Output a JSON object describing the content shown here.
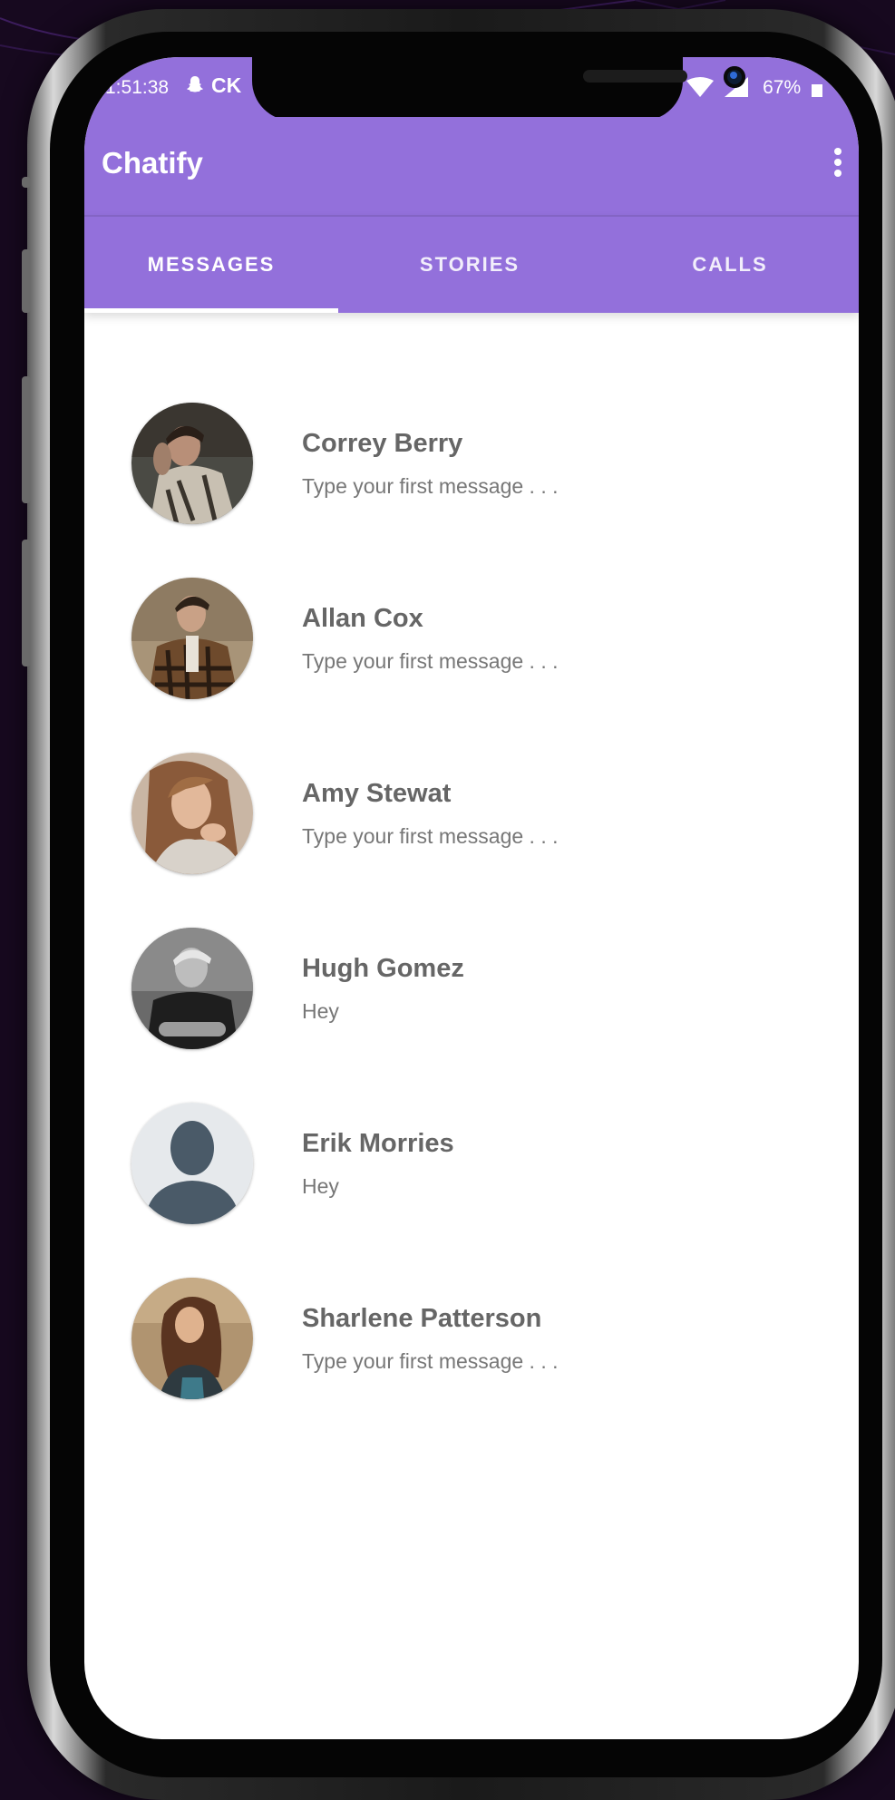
{
  "status_bar": {
    "time": "1:51:38",
    "carrier_text": "CK",
    "battery": "67%"
  },
  "app_bar": {
    "title": "Chatify",
    "menu_icon": "more-vert-icon"
  },
  "tabs": [
    {
      "label": "MESSAGES",
      "active": true
    },
    {
      "label": "STORIES",
      "active": false
    },
    {
      "label": "CALLS",
      "active": false
    }
  ],
  "chats": [
    {
      "name": "Correy Berry",
      "preview": "Type your first message . . ."
    },
    {
      "name": "Allan Cox",
      "preview": "Type your first message . . ."
    },
    {
      "name": "Amy Stewat",
      "preview": "Type your first message . . ."
    },
    {
      "name": "Hugh Gomez",
      "preview": "Hey"
    },
    {
      "name": "Erik Morries",
      "preview": "Hey"
    },
    {
      "name": "Sharlene Patterson",
      "preview": "Type your first message . . ."
    }
  ],
  "colors": {
    "primary": "#9370db",
    "background": "#17091f",
    "name_text": "#666666",
    "preview_text": "#777777"
  }
}
